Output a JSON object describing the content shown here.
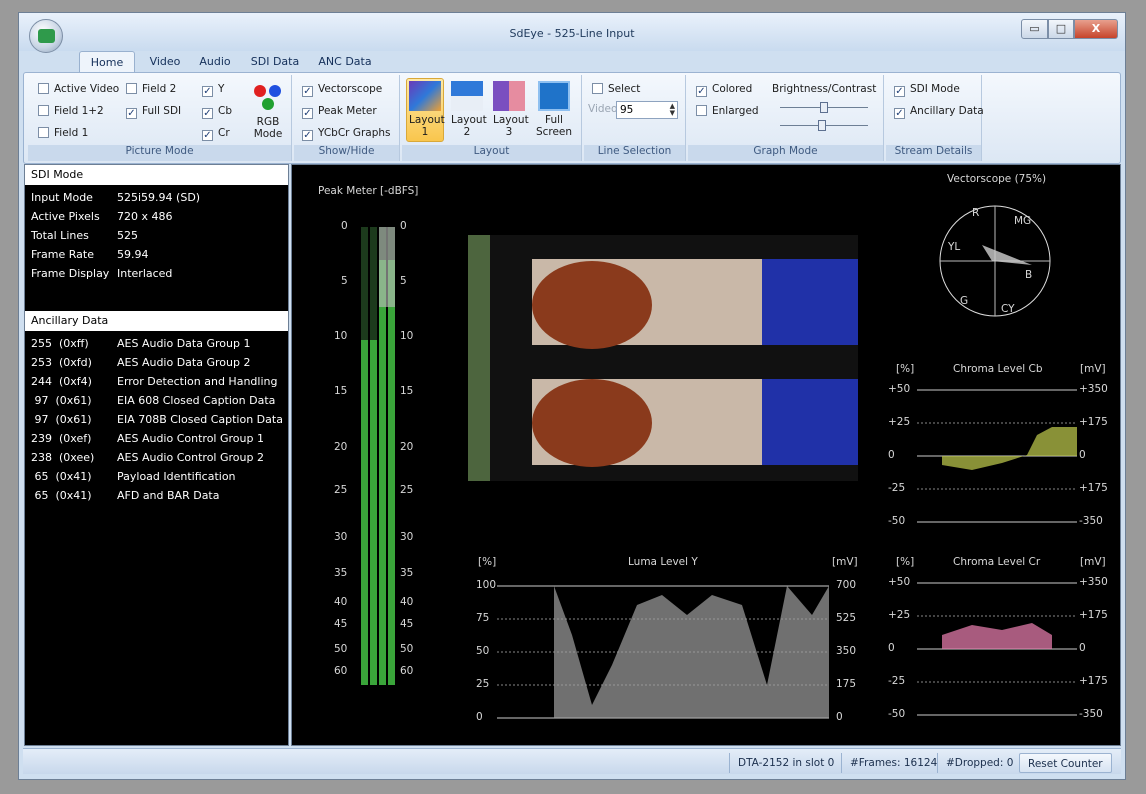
{
  "window": {
    "title": "SdEye - 525-Line Input",
    "minimize": "▭",
    "maximize": "□",
    "close": "X"
  },
  "tabs": [
    {
      "label": "Home",
      "active": true
    },
    {
      "label": "Video",
      "active": false
    },
    {
      "label": "Audio",
      "active": false
    },
    {
      "label": "SDI Data",
      "active": false
    },
    {
      "label": "ANC Data",
      "active": false
    }
  ],
  "ribbon": {
    "picture_mode": {
      "label": "Picture Mode",
      "active_video": "Active Video",
      "field2": "Field 2",
      "field12": "Field 1+2",
      "full_sdi": "Full SDI",
      "field1": "Field 1",
      "y": "Y",
      "cb": "Cb",
      "cr": "Cr",
      "rgb_mode": "RGB Mode"
    },
    "show_hide": {
      "label": "Show/Hide",
      "vectorscope": "Vectorscope",
      "peak_meter": "Peak Meter",
      "ycbcr": "YCbCr Graphs"
    },
    "layout": {
      "label": "Layout",
      "layout1": "Layout 1",
      "layout2": "Layout 2",
      "layout3": "Layout 3",
      "full_screen": "Full Screen"
    },
    "line_selection": {
      "label": "Line Selection",
      "select": "Select",
      "video_label": "Video",
      "video_value": "95"
    },
    "graph_mode": {
      "label": "Graph Mode",
      "colored": "Colored",
      "enlarged": "Enlarged",
      "brightness": "Brightness/Contrast"
    },
    "stream_details": {
      "label": "Stream Details",
      "sdi_mode": "SDI Mode",
      "ancillary": "Ancillary Data"
    },
    "check_mark": "✓"
  },
  "sdi_mode": {
    "title": "SDI Mode",
    "rows": [
      {
        "key": "Input Mode",
        "value": "525i59.94  (SD)"
      },
      {
        "key": "Active Pixels",
        "value": "720 x 486"
      },
      {
        "key": "Total Lines",
        "value": "525"
      },
      {
        "key": "Frame Rate",
        "value": "59.94"
      },
      {
        "key": "Frame Display",
        "value": "Interlaced"
      }
    ]
  },
  "ancillary_data": {
    "title": "Ancillary Data",
    "rows": [
      {
        "id": "255  (0xff)",
        "name": "AES Audio Data Group 1"
      },
      {
        "id": "253  (0xfd)",
        "name": "AES Audio Data Group 2"
      },
      {
        "id": "244  (0xf4)",
        "name": "Error Detection and Handling"
      },
      {
        "id": " 97  (0x61)",
        "name": "EIA 608 Closed Caption Data"
      },
      {
        "id": " 97  (0x61)",
        "name": "EIA 708B Closed Caption Data"
      },
      {
        "id": "239  (0xef)",
        "name": "AES Audio Control Group 1"
      },
      {
        "id": "238  (0xee)",
        "name": "AES Audio Control Group 2"
      },
      {
        "id": " 65  (0x41)",
        "name": "Payload Identification"
      },
      {
        "id": " 65  (0x41)",
        "name": "AFD and BAR Data"
      }
    ]
  },
  "peak_meter": {
    "title": "Peak Meter [-dBFS]",
    "ticks": [
      "0",
      "5",
      "10",
      "15",
      "20",
      "25",
      "30",
      "35",
      "40",
      "45",
      "50",
      "60"
    ]
  },
  "vectorscope": {
    "title": "Vectorscope (75%)",
    "targets": [
      "R",
      "MG",
      "YL",
      "B",
      "G",
      "CY"
    ]
  },
  "luma": {
    "title": "Luma Level Y",
    "unit_left": "[%]",
    "unit_right": "[mV]",
    "left_ticks": [
      "100",
      "75",
      "50",
      "25",
      "0"
    ],
    "right_ticks": [
      "700",
      "525",
      "350",
      "175",
      "0"
    ]
  },
  "chroma_cb": {
    "title": "Chroma Level Cb",
    "unit_left": "[%]",
    "unit_right": "[mV]",
    "left_ticks": [
      "+50",
      "+25",
      "0",
      "-25",
      "-50"
    ],
    "right_ticks": [
      "+350",
      "+175",
      "0",
      "+175",
      "-350"
    ]
  },
  "chroma_cr": {
    "title": "Chroma Level Cr",
    "unit_left": "[%]",
    "unit_right": "[mV]",
    "left_ticks": [
      "+50",
      "+25",
      "0",
      "-25",
      "-50"
    ],
    "right_ticks": [
      "+350",
      "+175",
      "0",
      "+175",
      "-350"
    ]
  },
  "status": {
    "device": "DTA-2152 in slot 0",
    "frames": "#Frames: 16124",
    "dropped": "#Dropped: 0",
    "reset": "Reset Counter"
  }
}
